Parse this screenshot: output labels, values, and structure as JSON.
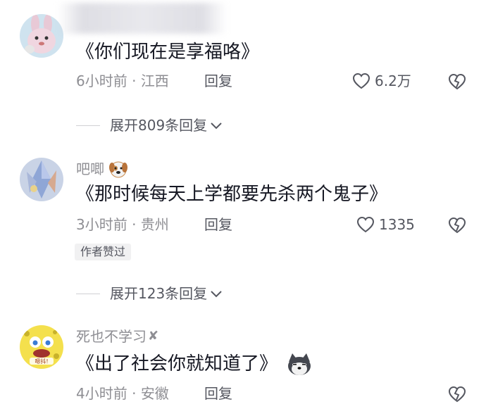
{
  "comments": [
    {
      "username": "",
      "text": "《你们现在是享福咯》",
      "time": "6小时前",
      "location": "江西",
      "reply_label": "回复",
      "likes": "6.2万",
      "expand_label": "展开809条回复"
    },
    {
      "username": "吧唧",
      "text": "《那时候每天上学都要先杀两个鬼子》",
      "time": "3小时前",
      "location": "贵州",
      "reply_label": "回复",
      "likes": "1335",
      "author_badge": "作者赞过",
      "expand_label": "展开123条回复"
    },
    {
      "username": "死也不学习",
      "username_suffix": "✘",
      "text": "《出了社会你就知道了》",
      "time": "4小时前",
      "location": "安徽",
      "reply_label": "回复",
      "avatar_caption": "嗯抖!"
    }
  ],
  "meta_separator": "·",
  "icons": {
    "like": "heart-outline-icon",
    "dislike": "broken-heart-icon",
    "expand": "chevron-down-icon",
    "emoji_dog": "dog-face-emoji-icon",
    "emoji_husky": "husky-face-emoji-icon"
  },
  "colors": {
    "primary_text": "#161823",
    "secondary_text": "#8e8e93",
    "action_text": "#555760",
    "badge_bg": "#f1f1f2"
  }
}
